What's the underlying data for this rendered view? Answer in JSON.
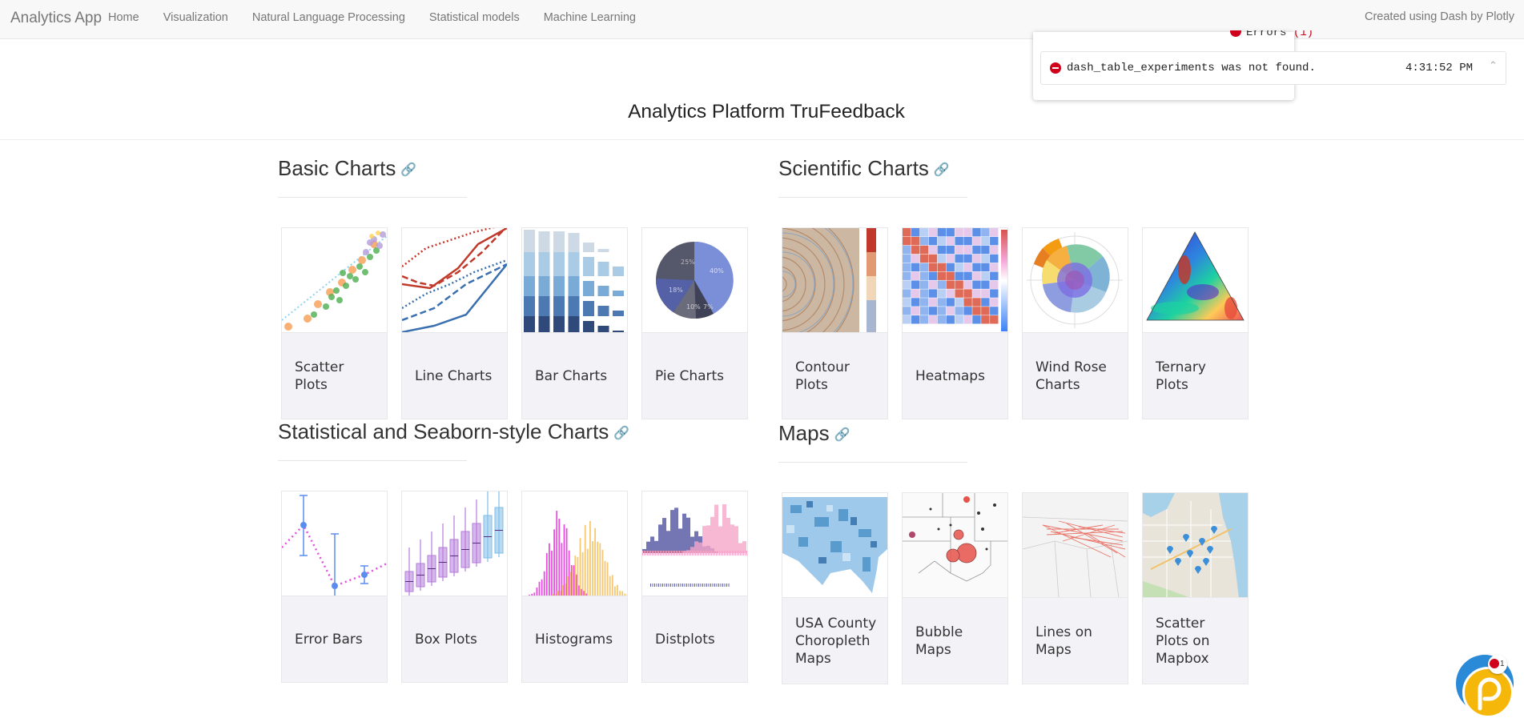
{
  "navbar": {
    "brand": "Analytics App",
    "items": [
      {
        "label": "Home"
      },
      {
        "label": "Visualization"
      },
      {
        "label": "Natural Language Processing"
      },
      {
        "label": "Statistical models"
      },
      {
        "label": "Machine Learning"
      }
    ],
    "right_text": "Created using Dash by Plotly"
  },
  "errors": {
    "header_label": "Errors",
    "count": "(1)",
    "items": [
      {
        "message": "dash_table_experiments was not found.",
        "time": "4:31:52 PM"
      }
    ],
    "status_color": "#d0021b"
  },
  "page": {
    "title": "Analytics Platform TruFeedback"
  },
  "sections": [
    {
      "title": "Basic Charts",
      "icon": "link-icon",
      "cards": [
        {
          "label": "Scatter Plots",
          "icon": "scatter-thumbnail"
        },
        {
          "label": "Line Charts",
          "icon": "line-thumbnail"
        },
        {
          "label": "Bar Charts",
          "icon": "bar-thumbnail"
        },
        {
          "label": "Pie Charts",
          "icon": "pie-thumbnail"
        }
      ]
    },
    {
      "title": "Scientific Charts",
      "icon": "link-icon",
      "cards": [
        {
          "label": "Contour Plots",
          "icon": "contour-thumbnail"
        },
        {
          "label": "Heatmaps",
          "icon": "heatmap-thumbnail"
        },
        {
          "label": "Wind Rose Charts",
          "icon": "windrose-thumbnail"
        },
        {
          "label": "Ternary Plots",
          "icon": "ternary-thumbnail"
        }
      ]
    },
    {
      "title": "Statistical and Seaborn-style Charts",
      "icon": "link-icon",
      "cards": [
        {
          "label": "Error Bars",
          "icon": "errorbar-thumbnail"
        },
        {
          "label": "Box Plots",
          "icon": "boxplot-thumbnail"
        },
        {
          "label": "Histograms",
          "icon": "histogram-thumbnail"
        },
        {
          "label": "Distplots",
          "icon": "distplot-thumbnail"
        }
      ]
    },
    {
      "title": "Maps",
      "icon": "link-icon",
      "cards": [
        {
          "label": "USA County Choropleth Maps",
          "icon": "choropleth-thumbnail"
        },
        {
          "label": "Bubble Maps",
          "icon": "bubblemap-thumbnail"
        },
        {
          "label": "Lines on Maps",
          "icon": "linesmap-thumbnail"
        },
        {
          "label": "Scatter Plots on Mapbox",
          "icon": "mapbox-thumbnail"
        }
      ]
    }
  ],
  "pie_labels": [
    "25%",
    "40%",
    "18%",
    "10%",
    "7%"
  ],
  "chat_widget": {
    "badge_count": "1",
    "icon": "chat-icon"
  }
}
